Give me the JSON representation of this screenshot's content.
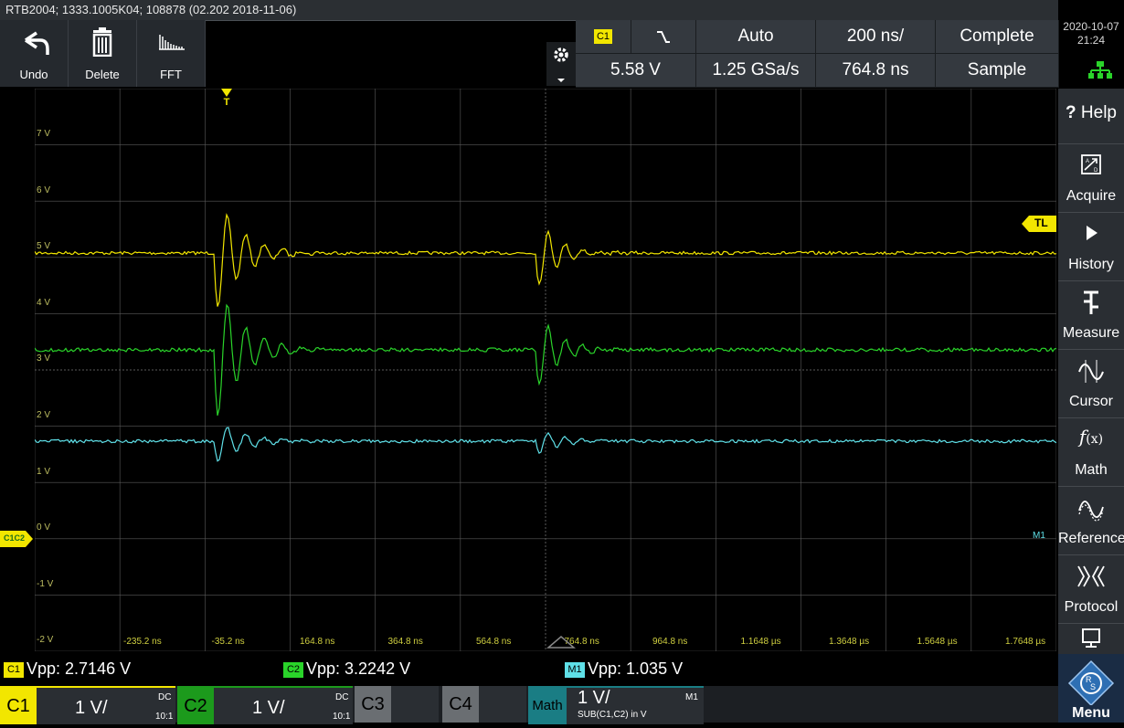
{
  "title_bar": "RTB2004; 1333.1005K04; 108878 (02.202 2018-11-06)",
  "datetime": {
    "date": "2020-10-07",
    "time": "21:24"
  },
  "toolbar": [
    {
      "label": "Undo",
      "icon": "undo-icon"
    },
    {
      "label": "Delete",
      "icon": "trash-icon"
    },
    {
      "label": "FFT",
      "icon": "fft-icon"
    }
  ],
  "acquisition": {
    "trigger_source": "C1",
    "trigger_level": "5.58 V",
    "trigger_mode": "Auto",
    "sample_rate": "1.25 GSa/s",
    "time_scale": "200 ns/",
    "trigger_position": "764.8 ns",
    "record_state": "Complete",
    "acq_mode": "Sample"
  },
  "sidebar": [
    {
      "label": "Help",
      "icon": "help-icon"
    },
    {
      "label": "Acquire",
      "icon": "acquire-icon"
    },
    {
      "label": "History",
      "icon": "play-icon"
    },
    {
      "label": "Measure",
      "icon": "measure-icon"
    },
    {
      "label": "Cursor",
      "icon": "cursor-icon"
    },
    {
      "label": "Math",
      "icon": "math-icon"
    },
    {
      "label": "References",
      "icon": "references-icon"
    },
    {
      "label": "Protocol",
      "icon": "protocol-icon"
    }
  ],
  "menu_label": "Menu",
  "y_axis": [
    "7 V",
    "6 V",
    "5 V",
    "4 V",
    "3 V",
    "2 V",
    "1 V",
    "0 V",
    "-1 V",
    "-2 V"
  ],
  "x_axis": [
    "-235.2 ns",
    "-35.2 ns",
    "164.8 ns",
    "364.8 ns",
    "564.8 ns",
    "764.8 ns",
    "964.8 ns",
    "1.1648 µs",
    "1.3648 µs",
    "1.5648 µs",
    "1.7648 µs"
  ],
  "markers": {
    "trigger": "T",
    "trigger_level": "TL",
    "math": "M1",
    "ground": "C1C2"
  },
  "measurements": [
    {
      "badge": "C1",
      "text": "Vpp: 2.7146 V",
      "color": "#f2e600"
    },
    {
      "badge": "C2",
      "text": "Vpp: 3.2242 V",
      "color": "#2ad42a"
    },
    {
      "badge": "M1",
      "text": "Vpp: 1.035 V",
      "color": "#5fe0e8"
    }
  ],
  "channels": [
    {
      "name": "C1",
      "scale": "1 V/",
      "coupling": "DC",
      "probe": "10:1",
      "color": "#f2e600"
    },
    {
      "name": "C2",
      "scale": "1 V/",
      "coupling": "DC",
      "probe": "10:1",
      "color": "#1c9a1c"
    },
    {
      "name": "C3",
      "color": "#6a6e72"
    },
    {
      "name": "C4",
      "color": "#6a6e72"
    },
    {
      "name": "Math",
      "scale": "1 V/",
      "label": "M1",
      "formula": "SUB(C1,C2) in V",
      "color": "#1a7d84"
    }
  ],
  "colors": {
    "ch1": "#f2e600",
    "ch2": "#2ad42a",
    "math": "#5fe0e8",
    "grid": "#5a5a5a"
  }
}
